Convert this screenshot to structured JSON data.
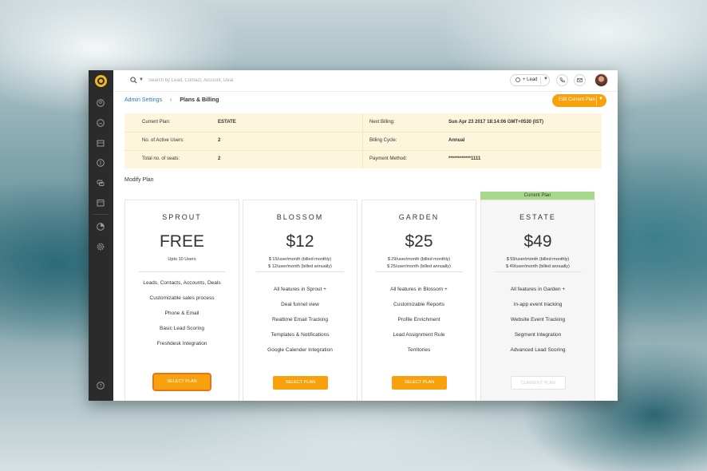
{
  "topbar": {
    "search_placeholder": "Search by Lead, Contact, Account, Deal",
    "lead_button": "+ Lead"
  },
  "breadcrumb": {
    "parent": "Admin Settings",
    "current": "Plans & Billing"
  },
  "edit_plan_button": "Edit Current Plan",
  "billing_info": {
    "current_plan_label": "Current Plan:",
    "current_plan_value": "ESTATE",
    "active_users_label": "No. of Active Users:",
    "active_users_value": "2",
    "seats_label": "Total no. of seats:",
    "seats_value": "2",
    "next_billing_label": "Next Billing:",
    "next_billing_value": "Sun Apr 23 2017 18:14:06 GMT+0530 (IST)",
    "billing_cycle_label": "Billing Cycle:",
    "billing_cycle_value": "Annual",
    "payment_method_label": "Payment Method:",
    "payment_method_value": "************1111"
  },
  "modify_plan_title": "Modify Plan",
  "current_plan_tag": "Current Plan",
  "plans": [
    {
      "name": "SPROUT",
      "price": "FREE",
      "sub1": "Upto 10 Users",
      "sub2": "",
      "features": [
        "Leads, Contacts, Accounts, Deals",
        "Customizable sales process",
        "Phone & Email",
        "Basic Lead Scoring",
        "Freshdesk Integration"
      ],
      "button": "SELECT PLAN"
    },
    {
      "name": "BLOSSOM",
      "price": "$12",
      "sub1": "$ 15/user/month (billed monthly)",
      "sub2": "$ 12/user/month (billed annually)",
      "features": [
        "All features in Sprout +",
        "Deal funnel view",
        "Realtime Email Tracking",
        "Templates & Notifications",
        "Google Calender Integration"
      ],
      "button": "SELECT PLAN"
    },
    {
      "name": "GARDEN",
      "price": "$25",
      "sub1": "$ 29/user/month (billed monthly)",
      "sub2": "$ 25/user/month (billed annually)",
      "features": [
        "All features in Blossom +",
        "Customizable Reports",
        "Profile Enrichment",
        "Lead Assignment Rule",
        "Territories"
      ],
      "button": "SELECT PLAN"
    },
    {
      "name": "ESTATE",
      "price": "$49",
      "sub1": "$ 59/user/month (billed monthly)",
      "sub2": "$ 49/user/month (billed annually)",
      "features": [
        "All features in Garden +",
        "In-app event tracking",
        "Website Event Tracking",
        "Segment Integration",
        "Advanced Lead Scoring"
      ],
      "button": "CURRENT PLAN"
    }
  ],
  "sidebar_icons": [
    "contacts-icon",
    "accounts-icon",
    "deals-icon",
    "revenue-icon",
    "conversations-icon",
    "calendar-icon",
    "reports-icon",
    "settings-icon",
    "help-icon"
  ],
  "colors": {
    "accent": "#f7a10c",
    "sidebar": "#2b2b2b",
    "info_bg": "#fdf6dc",
    "current_tag": "#a6d98a",
    "link": "#2f75c6"
  }
}
